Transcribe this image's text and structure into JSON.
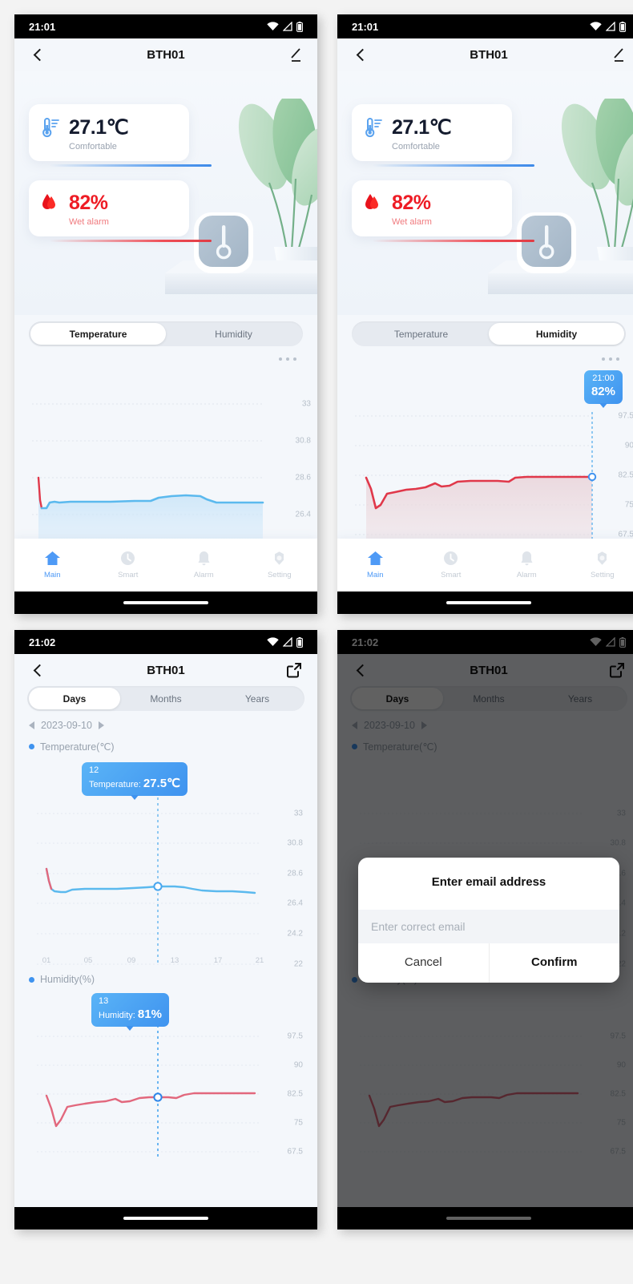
{
  "screens": {
    "s1": {
      "status": {
        "time": "21:01"
      },
      "nav": {
        "title": "BTH01",
        "back_icon": "chevron-left-icon",
        "action_icon": "edit-pencil-icon"
      },
      "temp_card": {
        "value": "27.1℃",
        "status": "Comfortable",
        "icon": "thermometer-icon"
      },
      "hum_card": {
        "value": "82%",
        "status": "Wet alarm",
        "icon": "water-drop-icon"
      },
      "segment": {
        "options": [
          "Temperature",
          "Humidity"
        ],
        "selected": "Temperature"
      },
      "more_icon": "more-horizontal-icon",
      "tabs": [
        {
          "label": "Main",
          "icon": "home-icon",
          "active": true
        },
        {
          "label": "Smart",
          "icon": "clock-icon",
          "active": false
        },
        {
          "label": "Alarm",
          "icon": "bell-icon",
          "active": false
        },
        {
          "label": "Setting",
          "icon": "gear-icon",
          "active": false
        }
      ]
    },
    "s2": {
      "status": {
        "time": "21:01"
      },
      "nav": {
        "title": "BTH01"
      },
      "temp_card": {
        "value": "27.1℃",
        "status": "Comfortable"
      },
      "hum_card": {
        "value": "82%",
        "status": "Wet alarm"
      },
      "segment": {
        "options": [
          "Temperature",
          "Humidity"
        ],
        "selected": "Humidity"
      },
      "tooltip": {
        "line1": "21:00",
        "line2": "82%"
      }
    },
    "s3": {
      "status": {
        "time": "21:02"
      },
      "nav": {
        "title": "BTH01",
        "action_icon": "share-external-icon"
      },
      "range_tabs": {
        "options": [
          "Days",
          "Months",
          "Years"
        ],
        "selected": "Days"
      },
      "date": "2023-09-10",
      "temp_legend": "Temperature(℃)",
      "hum_legend": "Humidity(%)",
      "temp_tooltip": {
        "line1": "12",
        "label": "Temperature:",
        "value": "27.5℃"
      },
      "hum_tooltip": {
        "line1": "13",
        "label": "Humidity:",
        "value": "81%"
      }
    },
    "s4": {
      "status": {
        "time": "21:02"
      },
      "dialog": {
        "title": "Enter email address",
        "input_placeholder": "Enter correct email",
        "input_value": "",
        "cancel": "Cancel",
        "confirm": "Confirm"
      }
    }
  },
  "colors": {
    "accent_blue": "#4e9af6",
    "temp_line": "#5bb9ee",
    "hum_line": "#e0384a",
    "hum_line_light": "#e26b7c",
    "alarm_red": "#ee1c25",
    "tooltip": "#3f93ef"
  },
  "chart_data": [
    {
      "id": "s1_temperature",
      "type": "line",
      "title": "Temperature",
      "ylabel": "℃",
      "yticks": [
        33,
        30.8,
        28.6,
        26.4
      ],
      "ylim": [
        25.2,
        34.1
      ],
      "values": [
        28.7,
        28.2,
        27.1,
        26.95,
        26.93,
        26.95,
        27.02,
        27.05,
        27.05,
        27.05,
        27.05,
        27.06,
        27.06,
        27.1,
        27.2,
        27.25,
        27.27,
        27.26,
        27.2,
        27.0,
        26.95,
        26.95,
        26.95,
        26.96
      ]
    },
    {
      "id": "s2_humidity",
      "type": "line",
      "title": "Humidity",
      "ylabel": "%",
      "yticks": [
        97.5,
        90,
        82.5,
        75,
        67.5
      ],
      "ylim": [
        64,
        101
      ],
      "values": [
        82.0,
        78.5,
        74.0,
        77.5,
        79.3,
        79.4,
        80.2,
        80.4,
        80.1,
        81.3,
        80.4,
        80.6,
        81.2,
        81.3,
        81.2,
        81.2,
        81.1,
        81.0,
        81.8,
        82.0,
        82.0,
        82.0,
        82.0,
        82.0
      ],
      "marker": {
        "x": 23,
        "label_time": "21:00",
        "label_value": "82%"
      }
    },
    {
      "id": "s3_temperature",
      "type": "line",
      "title": "Temperature(℃)",
      "xticks": [
        "01",
        "05",
        "09",
        "13",
        "17",
        "21"
      ],
      "yticks": [
        33,
        30.8,
        28.6,
        26.4,
        24.2,
        22
      ],
      "ylim": [
        21.5,
        33.6
      ],
      "values": [
        28.6,
        27.5,
        27.0,
        26.95,
        26.95,
        27.0,
        27.05,
        27.05,
        27.05,
        27.05,
        27.1,
        27.4,
        27.5,
        27.5,
        27.5,
        27.55,
        27.5,
        27.25,
        27.15,
        27.1,
        27.1,
        27.1,
        27.05,
        27.0
      ],
      "marker": {
        "x": 12,
        "label_x": "12",
        "label_value": "27.5℃"
      }
    },
    {
      "id": "s3_humidity",
      "type": "line",
      "title": "Humidity(%)",
      "yticks": [
        97.5,
        90,
        82.5,
        75,
        67.5
      ],
      "ylim": [
        64,
        101
      ],
      "values": [
        82.0,
        78.0,
        73.8,
        77.8,
        78.2,
        79.2,
        79.6,
        79.8,
        80.3,
        81.0,
        79.9,
        80.6,
        81.0,
        81.0,
        81.0,
        81.0,
        81.2,
        82.1,
        82.3,
        82.3,
        82.3,
        82.3,
        82.3,
        82.3
      ],
      "marker": {
        "x": 13,
        "label_x": "13",
        "label_value": "81%"
      }
    }
  ]
}
